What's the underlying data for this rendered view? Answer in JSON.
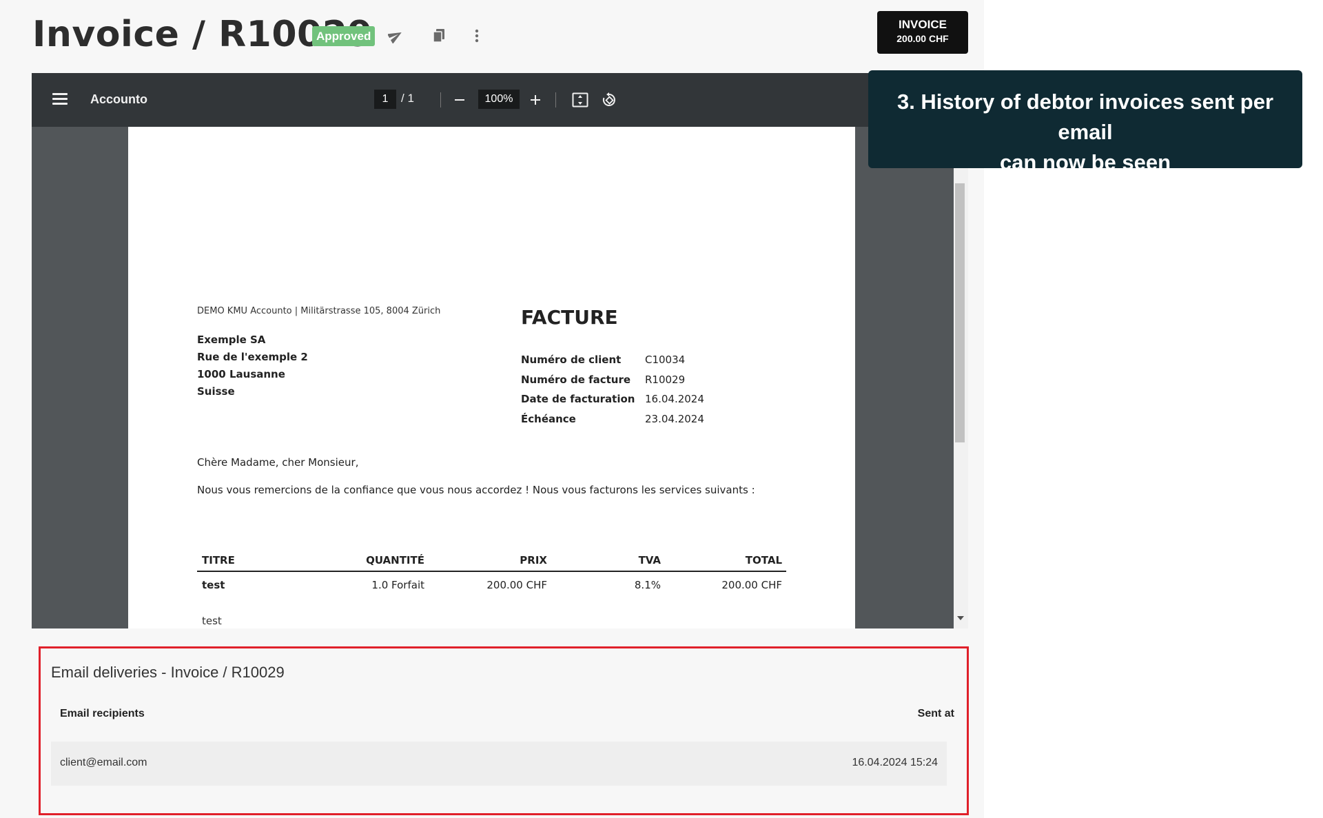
{
  "header": {
    "title": "Invoice / R10029",
    "status_badge": "Approved",
    "send_icon": "paper-plane-icon",
    "copy_icon": "copy-icon",
    "more_icon": "more-vertical-icon",
    "invoice_button": {
      "line1": "INVOICE",
      "line2": "200.00 CHF"
    }
  },
  "pdf_viewer": {
    "app_name": "Accounto",
    "page_current": "1",
    "page_total": "/ 1",
    "zoom": "100%",
    "document": {
      "sender_line": "DEMO KMU Accounto | Militärstrasse 105, 8004 Zürich",
      "recipient": [
        "Exemple SA",
        "Rue de l'exemple 2",
        "1000 Lausanne",
        "Suisse"
      ],
      "heading": "FACTURE",
      "meta": [
        {
          "label": "Numéro de client",
          "value": "C10034"
        },
        {
          "label": "Numéro de facture",
          "value": "R10029"
        },
        {
          "label": "Date de facturation",
          "value": "16.04.2024"
        },
        {
          "label": "Échéance",
          "value": "23.04.2024"
        }
      ],
      "greeting": "Chère Madame, cher Monsieur,",
      "intro": "Nous vous remercions de la confiance que vous nous accordez ! Nous vous facturons les services suivants :",
      "table": {
        "headers": [
          "TITRE",
          "QUANTITÉ",
          "PRIX",
          "TVA",
          "TOTAL"
        ],
        "rows": [
          [
            "test",
            "1.0 Forfait",
            "200.00 CHF",
            "8.1%",
            "200.00 CHF"
          ]
        ],
        "description": "test"
      }
    }
  },
  "callout": {
    "line1": "3. History of debtor invoices sent per email",
    "line2": "can now be seen"
  },
  "email_deliveries": {
    "title": "Email deliveries - Invoice / R10029",
    "col_recipients": "Email recipients",
    "col_sent_at": "Sent at",
    "rows": [
      {
        "recipient": "client@email.com",
        "sent_at": "16.04.2024 15:24"
      }
    ]
  }
}
